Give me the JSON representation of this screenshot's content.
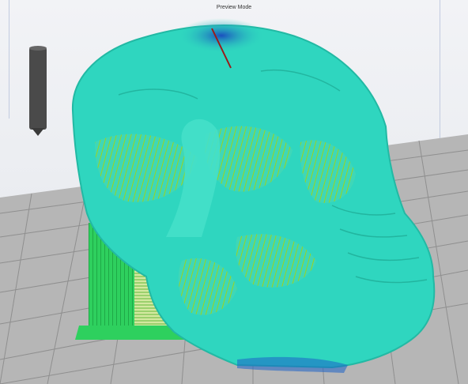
{
  "viewport": {
    "mode_label": "Preview Mode"
  },
  "colors": {
    "build_plate": "#b6b6b6",
    "grid_lines": "#8f8f8f",
    "model_surface": "#2fd6bf",
    "model_surface_light": "#45e0c9",
    "infill": "#a6d61e",
    "support": "#2ed05e",
    "top_layer": "#1c63c8",
    "nozzle": "#4a4a4a",
    "travel_line": "#9a1a1a"
  },
  "icons": {
    "nozzle": "nozzle-icon",
    "model": "skull-model"
  }
}
